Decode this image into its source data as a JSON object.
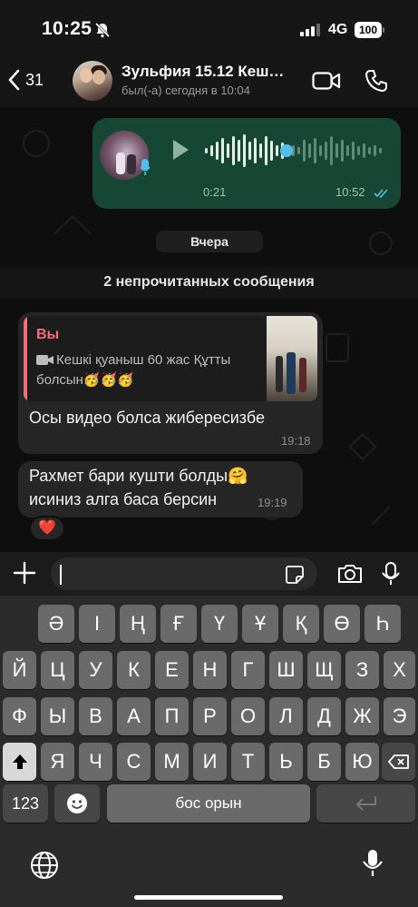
{
  "status_bar": {
    "time": "10:25",
    "network": "4G",
    "battery": "100"
  },
  "header": {
    "back_count": "31",
    "contact_name": "Зульфия 15.12 Кеш…",
    "last_seen": "был(-а) сегодня в 10:04"
  },
  "voice_message": {
    "duration": "0:21",
    "time": "10:52"
  },
  "date_separator": "Вчера",
  "unread_banner": "2 непрочитанных сообщения",
  "messages": [
    {
      "quote_author": "Вы",
      "quote_text": "Кешкі қуаныш 60 жас Құтты болсын🥳🥳🥳",
      "text": "Осы видео болса жибересизбе",
      "time": "19:18"
    },
    {
      "text_line1": "Рахмет бари кушти болды🤗",
      "text_line2": "исиниз алга баса берсин",
      "time": "19:19",
      "reaction": "❤️"
    }
  ],
  "keyboard": {
    "row1": [
      "Ә",
      "І",
      "Ң",
      "Ғ",
      "Ү",
      "Ұ",
      "Қ",
      "Ө",
      "Һ"
    ],
    "row2": [
      "Й",
      "Ц",
      "У",
      "К",
      "Е",
      "Н",
      "Г",
      "Ш",
      "Щ",
      "З",
      "Х"
    ],
    "row3": [
      "Ф",
      "Ы",
      "В",
      "А",
      "П",
      "Р",
      "О",
      "Л",
      "Д",
      "Ж",
      "Э"
    ],
    "row4": [
      "Я",
      "Ч",
      "С",
      "М",
      "И",
      "Т",
      "Ь",
      "Б",
      "Ю"
    ],
    "numbers_label": "123",
    "space_label": "бос орын"
  },
  "icons": {
    "back": "chevron-left-icon",
    "video_call": "video-camera-icon",
    "voice_call": "phone-icon",
    "play": "play-icon",
    "attach": "plus-icon",
    "sticker": "sticker-icon",
    "camera": "camera-icon",
    "mic": "microphone-icon",
    "shift": "shift-icon",
    "delete": "backspace-icon",
    "emoji": "emoji-icon",
    "return": "return-icon",
    "globe": "globe-icon"
  },
  "colors": {
    "outgoing_bubble": "#154734",
    "incoming_bubble": "#262626",
    "quote_accent": "#f1707a",
    "read_ticks": "#53bdeb",
    "voice_progress": "#53bdeb"
  }
}
